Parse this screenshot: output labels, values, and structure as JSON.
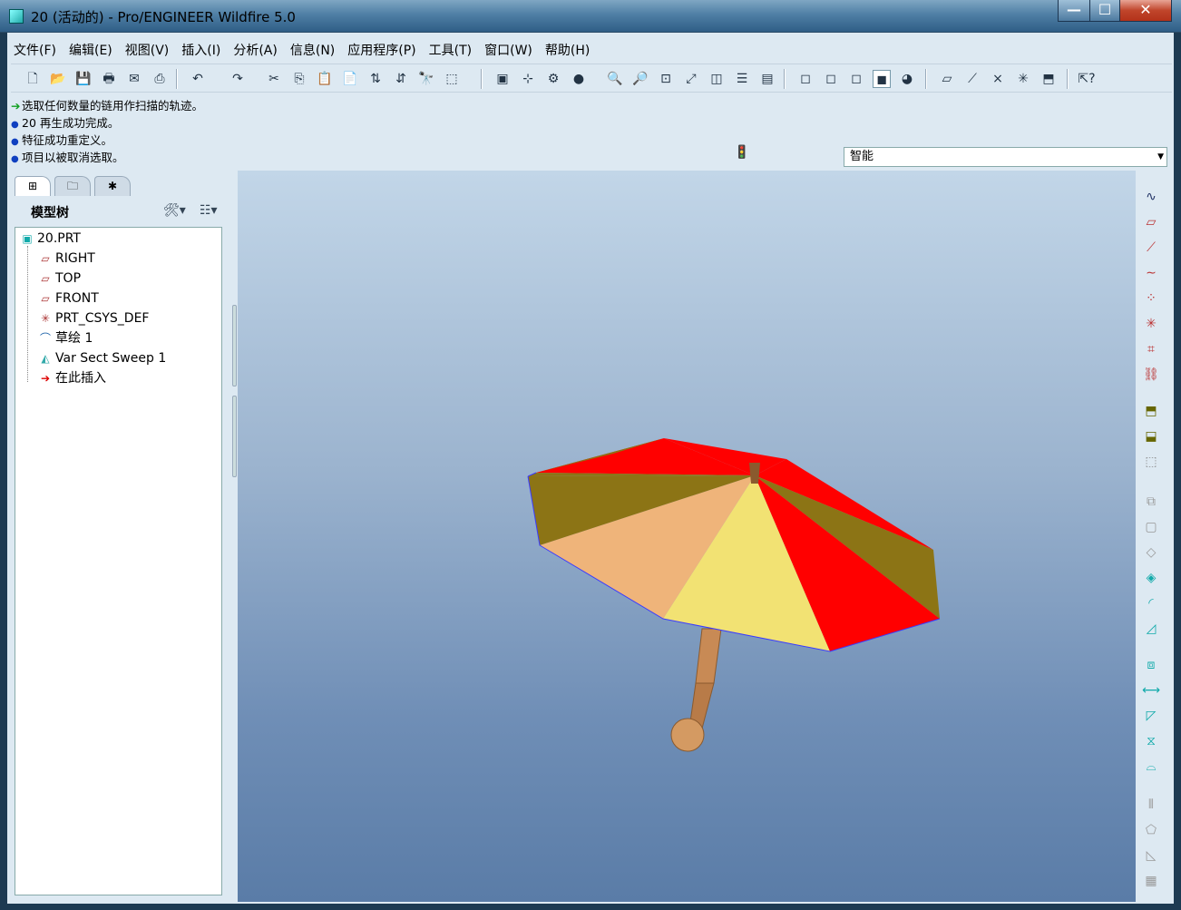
{
  "window": {
    "title": "20 (活动的) - Pro/ENGINEER Wildfire 5.0",
    "controls": {
      "minimize": "—",
      "maximize": "☐",
      "close": "✕"
    }
  },
  "menu": [
    "文件(F)",
    "编辑(E)",
    "视图(V)",
    "插入(I)",
    "分析(A)",
    "信息(N)",
    "应用程序(P)",
    "工具(T)",
    "窗口(W)",
    "帮助(H)"
  ],
  "messages": [
    {
      "type": "prompt",
      "text": "选取任何数量的链用作扫描的轨迹。"
    },
    {
      "type": "info",
      "text": "20 再生成功完成。"
    },
    {
      "type": "info",
      "text": "特征成功重定义。"
    },
    {
      "type": "info",
      "text": "项目以被取消选取。"
    }
  ],
  "selection_filter": {
    "value": "智能"
  },
  "model_tree": {
    "title": "模型树",
    "items": [
      {
        "label": "20.PRT",
        "icon": "part-icon"
      },
      {
        "label": "RIGHT",
        "icon": "datum-plane-icon"
      },
      {
        "label": "TOP",
        "icon": "datum-plane-icon"
      },
      {
        "label": "FRONT",
        "icon": "datum-plane-icon"
      },
      {
        "label": "PRT_CSYS_DEF",
        "icon": "csys-icon"
      },
      {
        "label": "草绘 1",
        "icon": "sketch-icon"
      },
      {
        "label": "Var Sect Sweep 1",
        "icon": "sweep-icon"
      },
      {
        "label": "在此插入",
        "icon": "insert-arrow-icon"
      }
    ]
  },
  "colors": {
    "canopy_red": "#ff0000",
    "canopy_olive": "#8c7415",
    "canopy_peach": "#efb47a",
    "canopy_yellow": "#f2e273",
    "handle": "#c88a55",
    "edge": "#3a3aff"
  }
}
